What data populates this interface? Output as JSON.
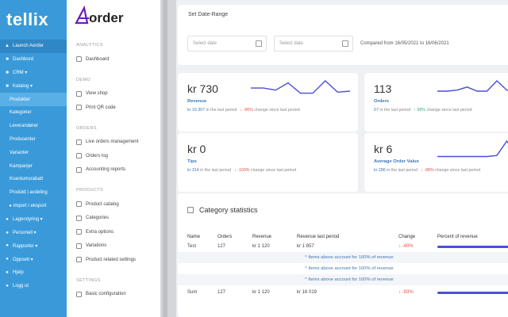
{
  "app": {
    "logo": "tellix",
    "brand_mark": "A",
    "brand_text": "order"
  },
  "sidebar_left": {
    "launch": "Launch Aorder",
    "items": [
      {
        "label": "Dashbord",
        "icon": "dashboard-icon"
      },
      {
        "label": "CRM ▾",
        "icon": "crm-icon"
      },
      {
        "label": "Katalog ▾",
        "icon": "catalog-icon"
      }
    ],
    "catalog_sub": [
      {
        "label": "Produkter",
        "active": true
      },
      {
        "label": "Kategorier"
      },
      {
        "label": "Leverandører"
      },
      {
        "label": "Produsenter"
      },
      {
        "label": "Varianter"
      },
      {
        "label": "Kampanjer"
      },
      {
        "label": "Kvantumsrabatt"
      },
      {
        "label": "Produkt i avdeling"
      },
      {
        "label": "▸ Import / eksport"
      }
    ],
    "bottom": [
      {
        "label": "Lagerstyring ▾",
        "icon": "stock-icon"
      },
      {
        "label": "Personell ▾",
        "icon": "staff-icon"
      },
      {
        "label": "Rapporter ▾",
        "icon": "reports-icon"
      },
      {
        "label": "Oppsett ▾",
        "icon": "settings-icon"
      },
      {
        "label": "Hjelp",
        "icon": "help-icon"
      },
      {
        "label": "Logg ut",
        "icon": "logout-icon"
      }
    ]
  },
  "sidebar_mid": {
    "sections": [
      {
        "title": "ANALYTICS",
        "items": [
          "Dashboard"
        ]
      },
      {
        "title": "DEMO",
        "items": [
          "View shop",
          "Print QR code"
        ]
      },
      {
        "title": "ORDERS",
        "items": [
          "Live orders management",
          "Orders log",
          "Accounting reports"
        ]
      },
      {
        "title": "PRODUCTS",
        "items": [
          "Product catalog",
          "Categories",
          "Extra options",
          "Variations",
          "Product related settings"
        ]
      },
      {
        "title": "SETTINGS",
        "items": [
          "Basic configuration"
        ]
      }
    ]
  },
  "date_range": {
    "title": "Set Date-Range",
    "start_placeholder": "Select date",
    "end_placeholder": "Select date",
    "compared": "Compared from 16/05/2021 to 16/06/2021"
  },
  "kpis": {
    "revenue": {
      "value": "kr 730",
      "label": "Revenue",
      "prev": "kr 10 307",
      "prev_text": " in the last period",
      "change": "↓ -96%",
      "change_text": " change since last period",
      "trend": "down",
      "spark": [
        0.35,
        0.35,
        0.45,
        0.1,
        0.6,
        0.6,
        0.0,
        0.55,
        0.5
      ]
    },
    "orders": {
      "value": "113",
      "label": "Orders",
      "prev": "57",
      "prev_text": " in the last period",
      "change": "↑ 98%",
      "change_text": " change since last period",
      "trend": "up",
      "spark": [
        0.5,
        0.5,
        0.45,
        0.3,
        0.5,
        0.5,
        0.0,
        0.45,
        0.45,
        0.4,
        0.1
      ]
    },
    "tips": {
      "value": "kr 0",
      "label": "Tips",
      "prev": "kr 314",
      "prev_text": " in the last period",
      "change": "↓ -100%",
      "change_text": " change since last period",
      "trend": "down",
      "spark": []
    },
    "aov": {
      "value": "kr 6",
      "label": "Average Order Value",
      "prev": "kr 286",
      "prev_text": " in the last period",
      "change": "↓ -98%",
      "change_text": " change since last period",
      "trend": "down",
      "spark": [
        0.75,
        0.75,
        0.75,
        0.75,
        0.75,
        0.75,
        0.7,
        0.0,
        0.7,
        0.6,
        0.25
      ]
    }
  },
  "category": {
    "title": "Category statistics",
    "headers": [
      "Name",
      "Orders",
      "Revenue",
      "Revenue last period",
      "Change",
      "Percent of revenue"
    ],
    "rows": [
      {
        "name": "Test",
        "orders": "127",
        "revenue": "kr 1 120",
        "last": "kr 1 857",
        "change": "↓ -40%",
        "pct": 1.0
      }
    ],
    "notes": [
      "^ Items above account for 100% of revenue",
      "^ Items above account for 100% of revenue",
      "^ Items above account for 100% of revenue"
    ],
    "sum": {
      "name": "Sum",
      "orders": "127",
      "revenue": "kr 1 120",
      "last": "kr 16 019",
      "change": "↓ -93%",
      "pct": 1.0
    }
  },
  "colors": {
    "sidebar": "#3a9ad9",
    "accent": "#4a4fd6",
    "red": "#e35050",
    "green": "#3bb07a",
    "brand_purple": "#6a1fb5"
  }
}
